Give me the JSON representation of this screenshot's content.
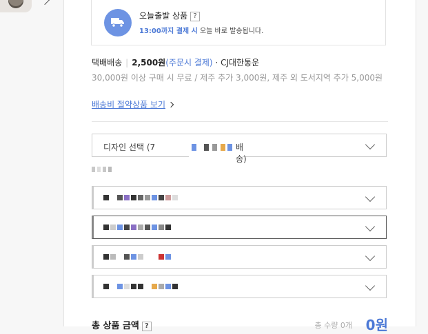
{
  "today_shipping": {
    "title": "오늘출발 상품",
    "help_label": "?",
    "deadline": "13:00까지 결제 시",
    "deadline_suffix": " 오늘 바로 발송됩니다."
  },
  "shipping": {
    "method": "택배배송",
    "fee": "2,500원",
    "fee_note": "(주문시 결제)",
    "carrier": "· CJ대한통운",
    "note": "30,000원 이상 구매 시 무료 / 제주 추가 3,000원, 제주 외 도서지역 추가 5,000원",
    "save_link": "배송비 절약상품 보기"
  },
  "options": {
    "design_select": {
      "label": "디자인 선택 (7",
      "suffix": "배송)"
    }
  },
  "total": {
    "label": "총 상품 금액",
    "help_label": "?",
    "quantity": "총 수량 0개",
    "price": "0원"
  },
  "colors": {
    "accent": "#4c79d6",
    "badge_bg": "#6d93e3"
  }
}
